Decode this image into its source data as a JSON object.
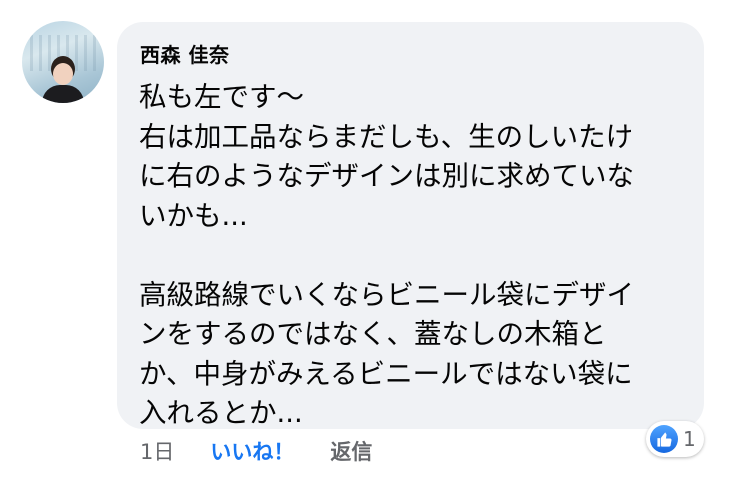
{
  "comment": {
    "author": "西森 佳奈",
    "lines": [
      "私も左です〜",
      "右は加工品ならまだしも、生のしいたけ",
      "に右のようなデザインは別に求めていな",
      "いかも...",
      "",
      "高級路線でいくならビニール袋にデザイ",
      "ンをするのではなく、蓋なしの木箱と",
      "か、中身がみえるビニールではない袋に",
      "入れるとか..."
    ]
  },
  "actions": {
    "time": "1日",
    "like_label": "いいね！",
    "reply_label": "返信"
  },
  "reactions": {
    "count": "1",
    "icon": "thumbs-up-icon",
    "color": "#1877f2"
  },
  "colors": {
    "bubble": "#f0f2f5",
    "link": "#1877f2",
    "muted": "#65676b"
  }
}
